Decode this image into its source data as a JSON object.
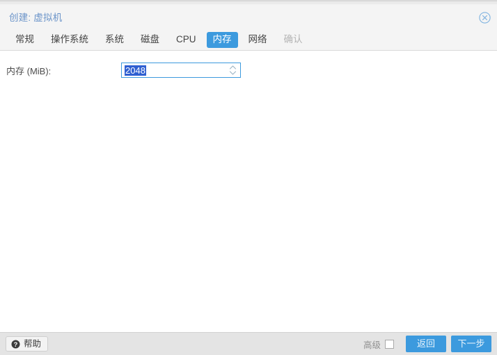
{
  "window": {
    "title": "创建: 虚拟机",
    "close_icon": "close-circle-icon"
  },
  "tabs": [
    {
      "label": "常规",
      "state": "normal"
    },
    {
      "label": "操作系统",
      "state": "normal"
    },
    {
      "label": "系统",
      "state": "normal"
    },
    {
      "label": "磁盘",
      "state": "normal"
    },
    {
      "label": "CPU",
      "state": "normal"
    },
    {
      "label": "内存",
      "state": "active"
    },
    {
      "label": "网络",
      "state": "normal"
    },
    {
      "label": "确认",
      "state": "disabled"
    }
  ],
  "form": {
    "memory": {
      "label": "内存 (MiB):",
      "value": "2048",
      "placeholder": "",
      "spinner_icon": "spinner-updown-icon"
    }
  },
  "footer": {
    "help_label": "帮助",
    "help_icon": "question-mark-icon",
    "advanced_label": "高级",
    "advanced_checked": false,
    "back_label": "返回",
    "next_label": "下一步"
  },
  "colors": {
    "accent_blue": "#3c9ade",
    "title_blue": "#6b94c9",
    "selection_blue": "#2f5fd1",
    "header_bg": "#f4f4f4",
    "footer_bg": "#e4e4e4",
    "disabled_text": "#b4b4b4"
  }
}
